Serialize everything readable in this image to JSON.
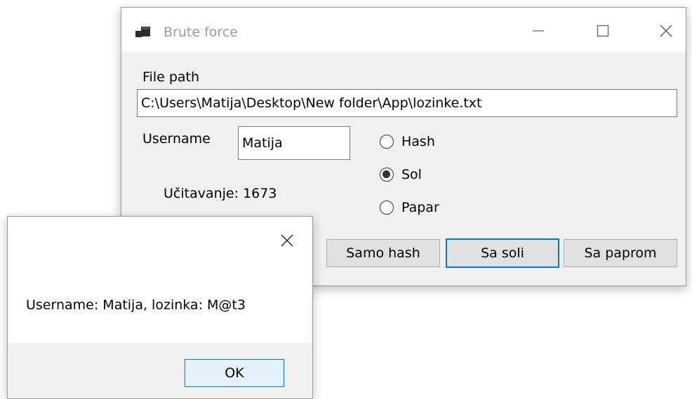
{
  "window": {
    "title": "Brute force",
    "icon": "app-window-icon",
    "controls": [
      "minimize-icon",
      "maximize-icon",
      "close-icon"
    ]
  },
  "form": {
    "file_path_label": "File path",
    "file_path_value": "C:\\Users\\Matija\\Desktop\\New folder\\App\\lozinke.txt",
    "username_label": "Username",
    "username_value": "Matija",
    "progress_label": "Učitavanje: 1673",
    "radios": {
      "hash": {
        "label": "Hash",
        "checked": false
      },
      "sol": {
        "label": "Sol",
        "checked": true
      },
      "papar": {
        "label": "Papar",
        "checked": false
      }
    },
    "buttons": {
      "samo_hash": "Samo hash",
      "sa_soli": "Sa soli",
      "sa_paprom": "Sa paprom"
    }
  },
  "messagebox": {
    "message": "Username: Matija, lozinka: M@t3",
    "ok_label": "OK",
    "close_icon": "close-icon"
  },
  "colors": {
    "accent": "#0078d7",
    "window_bg": "#f0f0f0",
    "titlebar_bg": "#ffffff"
  }
}
